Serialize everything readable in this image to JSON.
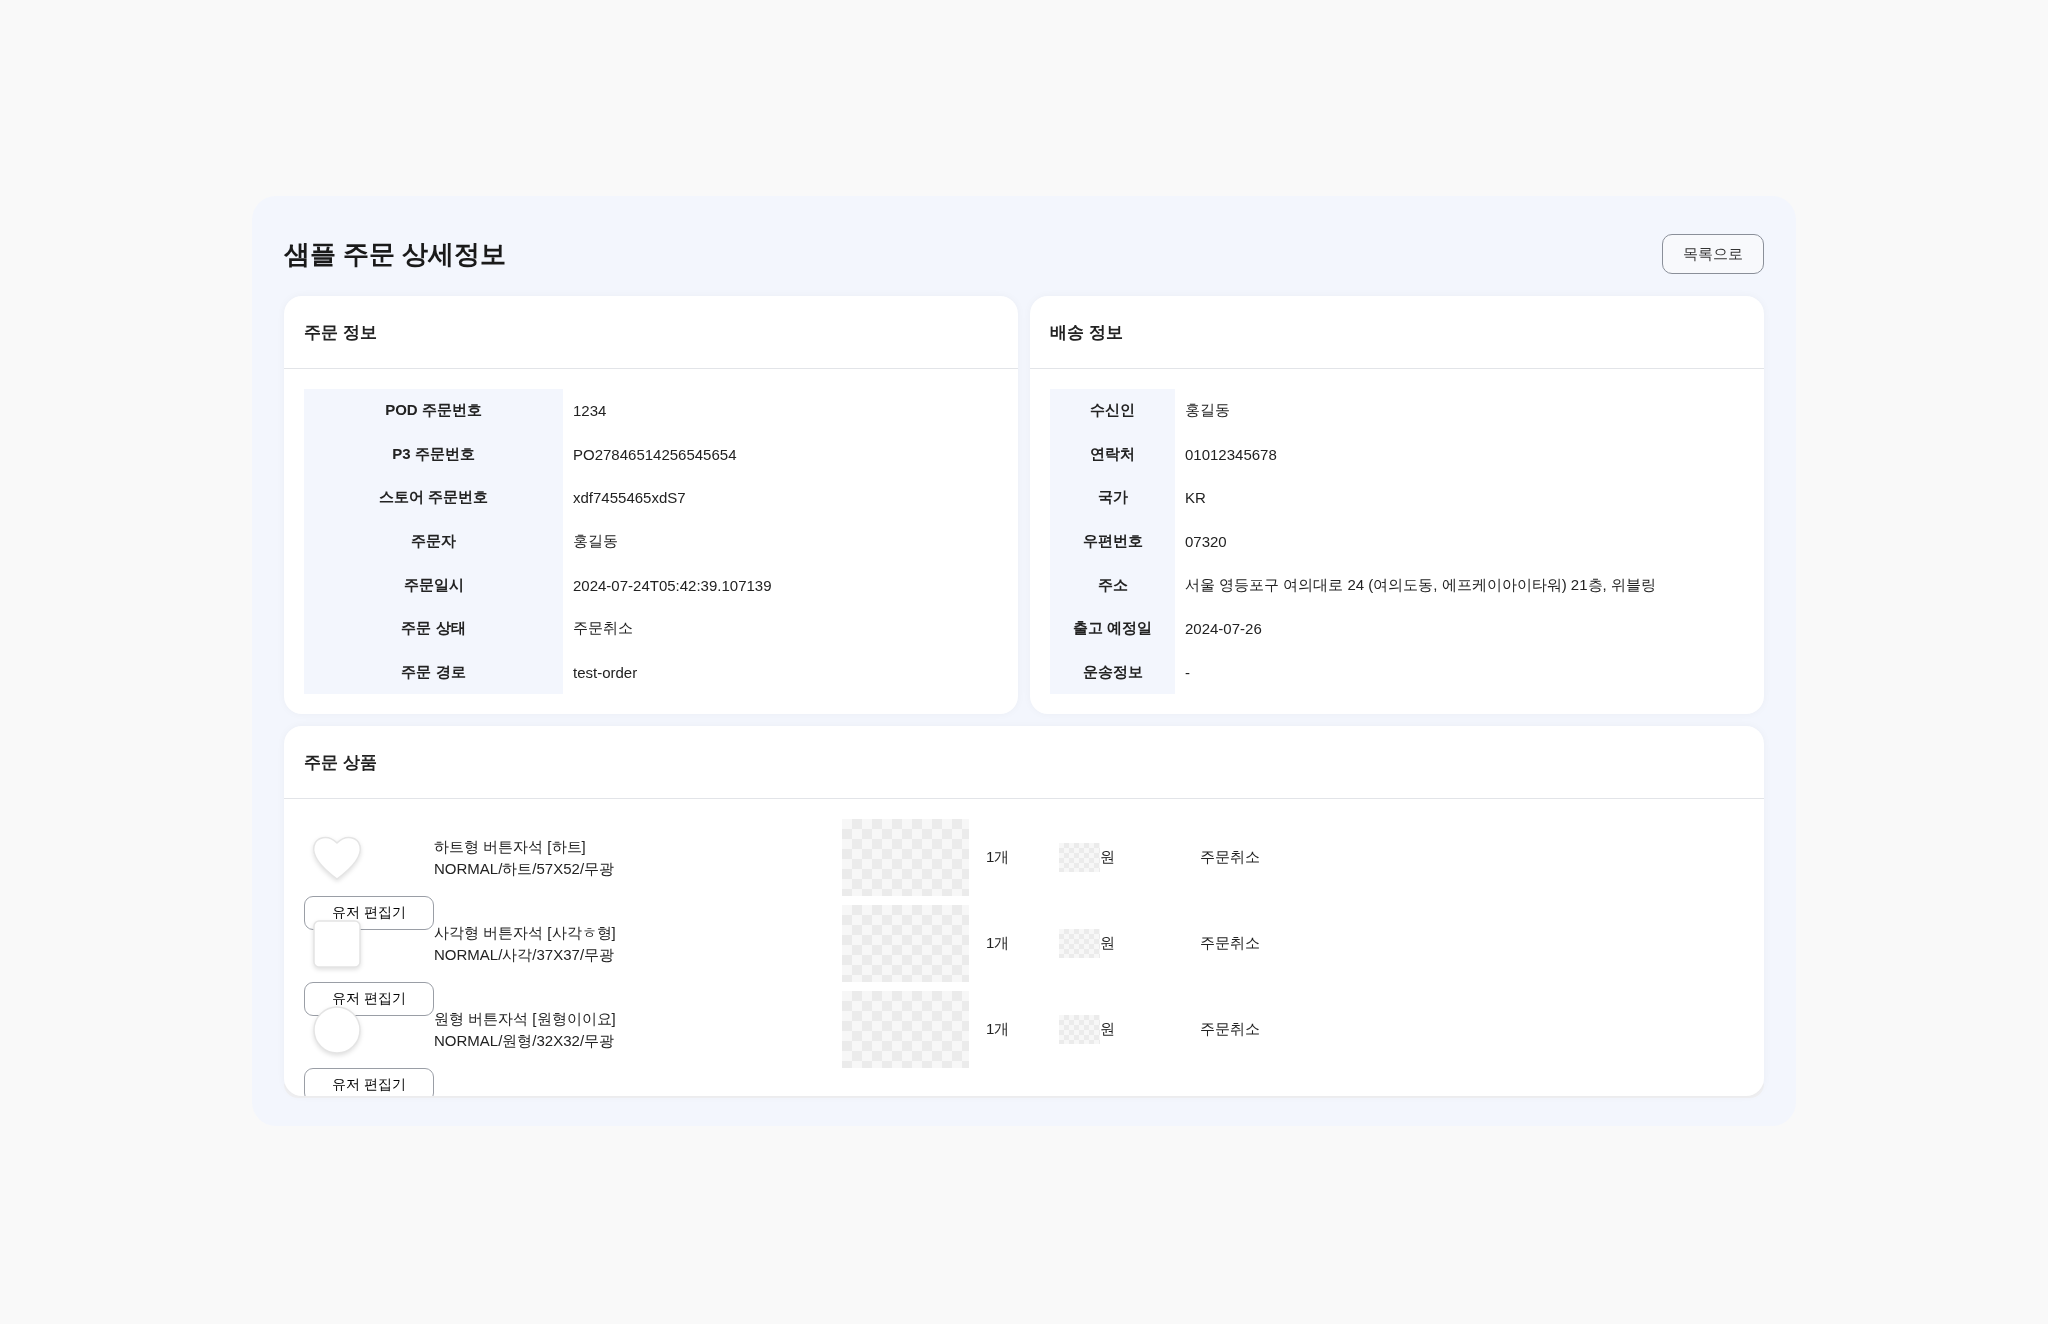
{
  "page": {
    "title": "샘플 주문 상세정보",
    "back_button": "목록으로"
  },
  "order_info": {
    "title": "주문 정보",
    "rows": [
      {
        "label": "POD 주문번호",
        "value": "1234"
      },
      {
        "label": "P3 주문번호",
        "value": "PO27846514256545654"
      },
      {
        "label": "스토어 주문번호",
        "value": "xdf7455465xdS7"
      },
      {
        "label": "주문자",
        "value": "홍길동"
      },
      {
        "label": "주문일시",
        "value": "2024-07-24T05:42:39.107139"
      },
      {
        "label": "주문 상태",
        "value": "주문취소"
      },
      {
        "label": "주문 경로",
        "value": "test-order"
      }
    ]
  },
  "shipping_info": {
    "title": "배송 정보",
    "rows": [
      {
        "label": "수신인",
        "value": "홍길동"
      },
      {
        "label": "연락처",
        "value": "01012345678"
      },
      {
        "label": "국가",
        "value": "KR"
      },
      {
        "label": "우편번호",
        "value": "07320"
      },
      {
        "label": "주소",
        "value": "서울 영등포구 여의대로 24 (여의도동, 에프케이아이타워) 21층, 위블링"
      },
      {
        "label": "출고 예정일",
        "value": "2024-07-26"
      },
      {
        "label": "운송정보",
        "value": "-"
      }
    ]
  },
  "products": {
    "title": "주문 상품",
    "items": [
      {
        "kind": "heart",
        "name": "하트형 버튼자석 [하트]",
        "option": "NORMAL/하트/57X52/무광",
        "quantity": "1개",
        "price_unit": "원",
        "status": "주문취소",
        "button": "유저 편집기"
      },
      {
        "kind": "square",
        "name": "사각형 버튼자석 [사각ㅎ형]",
        "option": "NORMAL/사각/37X37/무광",
        "quantity": "1개",
        "price_unit": "원",
        "status": "주문취소",
        "button": "유저 편집기"
      },
      {
        "kind": "circle",
        "name": "원형 버튼자석 [원형이이요]",
        "option": "NORMAL/원형/32X32/무광",
        "quantity": "1개",
        "price_unit": "원",
        "status": "주문취소",
        "button": "유저 편집기"
      }
    ]
  }
}
